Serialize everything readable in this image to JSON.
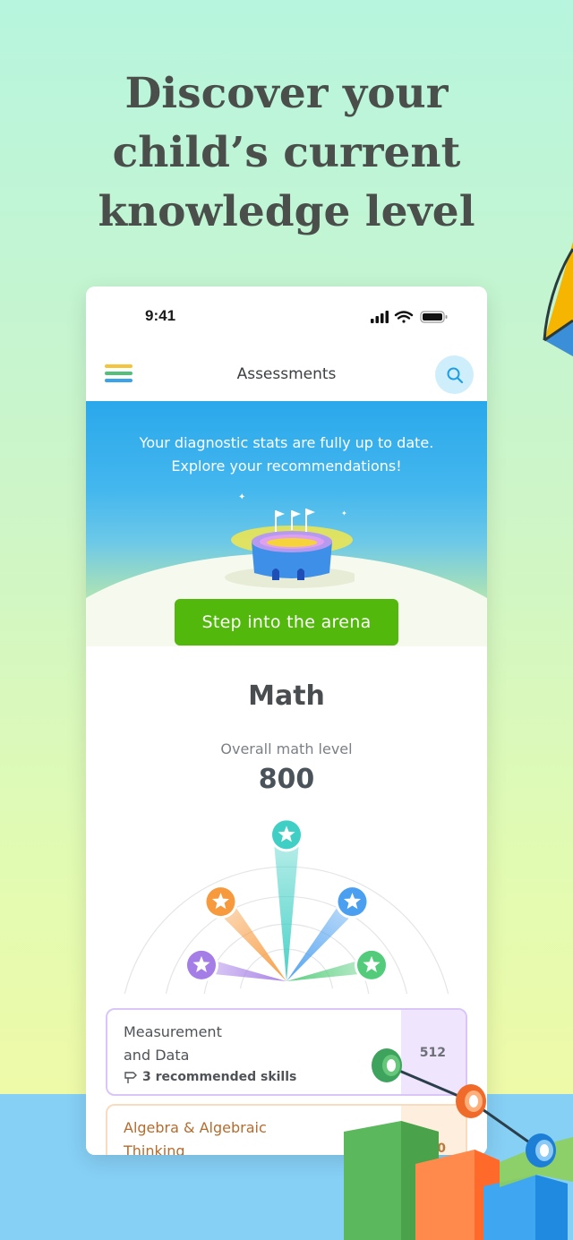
{
  "headline": {
    "line1": "Discover your",
    "line2": "child’s current",
    "line3": "knowledge level"
  },
  "status_bar": {
    "time": "9:41"
  },
  "nav": {
    "title": "Assessments"
  },
  "hero": {
    "line1": "Your diagnostic stats are fully up to date.",
    "line2": "Explore your recommendations!"
  },
  "arena_button": {
    "label": "Step into the arena"
  },
  "subject": {
    "name": "Math"
  },
  "level": {
    "label": "Overall math level",
    "value": "800"
  },
  "gauge": {
    "wedges": [
      {
        "name": "purple",
        "color": "#a57de6",
        "level": 0.52
      },
      {
        "name": "orange",
        "color": "#f79a3e",
        "level": 0.62
      },
      {
        "name": "teal",
        "color": "#3fcfc4",
        "level": 0.88
      },
      {
        "name": "blue",
        "color": "#4b9ff0",
        "level": 0.62
      },
      {
        "name": "green",
        "color": "#52cc7a",
        "level": 0.52
      }
    ]
  },
  "cards": [
    {
      "title_line1": "Measurement",
      "title_line2": "and Data",
      "recommendation": "3 recommended skills",
      "score": "512"
    },
    {
      "title_line1": "Algebra & Algebraic",
      "title_line2": "Thinking",
      "score": "0"
    }
  ],
  "colors": {
    "accent_green": "#52b80c",
    "hero_blue": "#2aa8eb",
    "search_bg": "#cfeefc"
  },
  "icons": [
    "hamburger-menu-icon",
    "search-icon",
    "signal-icon",
    "wifi-icon",
    "battery-icon",
    "star-icon",
    "signpost-icon",
    "kite-icon",
    "stadium-illustration"
  ]
}
